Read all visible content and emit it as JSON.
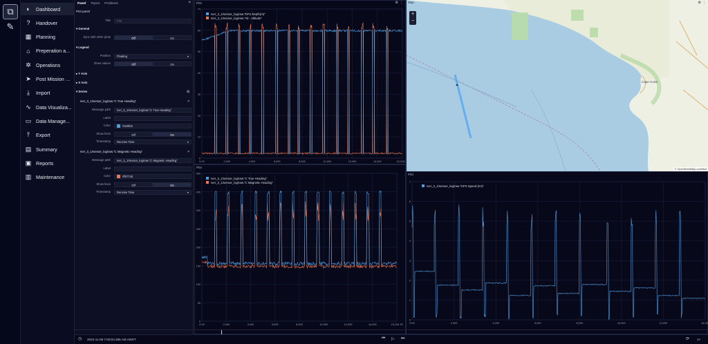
{
  "rail": {
    "icons": [
      "layers-icon",
      "wrench-icon"
    ]
  },
  "nav": {
    "items": [
      {
        "label": "Dashboard",
        "icon": "◐"
      },
      {
        "label": "Handover",
        "icon": "?"
      },
      {
        "label": "Planning",
        "icon": "▦"
      },
      {
        "label": "Preperation a...",
        "icon": "⌂"
      },
      {
        "label": "Operations",
        "icon": "✲"
      },
      {
        "label": "Post Mission a...",
        "icon": "➤"
      },
      {
        "label": "Import",
        "icon": "⤓"
      },
      {
        "label": "Data Visualiza...",
        "icon": "∿"
      },
      {
        "label": "Data Manage...",
        "icon": "▭"
      },
      {
        "label": "Export",
        "icon": "⤒"
      },
      {
        "label": "Summary",
        "icon": "▤"
      },
      {
        "label": "Reports",
        "icon": "▣"
      },
      {
        "label": "Maintenance",
        "icon": "▥"
      }
    ]
  },
  "panel": {
    "tabs": [
      "Panel",
      "Topics",
      "Problems"
    ],
    "close": "×",
    "subtitle": "Plot panel",
    "title_label": "Title",
    "title_placeholder": "Plot",
    "general": "General",
    "sync_label": "Sync with other plots",
    "off": "Off",
    "on": "On",
    "legend": "Legend",
    "position_label": "Position",
    "position_value": "Floating",
    "show_values_label": "Show values",
    "y_axis": "Y Axis",
    "x_axis": "X Axis",
    "series": "Series",
    "series1": {
      "header": "Iver_3_1/sensor_log/raw.\"C True Heading\"",
      "path_label": "Message path",
      "path": "Iver_3_1/sensor_log/raw.\"C True Heading\"",
      "label_label": "Label",
      "color_label": "Color",
      "color": "#4e9fe2",
      "lines_label": "Show lines",
      "ts_label": "Timestamp",
      "ts": "Receive Time"
    },
    "series2": {
      "header": "Iver_3_1/sensor_log/raw.\"C Magnetic Heading\"",
      "path_label": "Message path",
      "path": "Iver_3_1/sensor_log/raw.\"C Magnetic Heading\"",
      "label_label": "Label",
      "color_label": "Color",
      "color": "#f5774d",
      "lines_label": "Show lines",
      "ts_label": "Timestamp",
      "ts": "Receive Time"
    }
  },
  "plot1": {
    "title": "Plot",
    "legend": [
      "Iver_3_1/sensor_log/raw.\"DFS Depth(m)\"",
      "Iver_3_1/sensor_log/raw.\"Alt - Altitude\""
    ],
    "colors": [
      "#4e9fe2",
      "#f5774d"
    ],
    "yticks": [
      "74",
      "60",
      "50",
      "40",
      "30",
      "20",
      "10",
      "0"
    ],
    "xticks": [
      "0.00",
      "2,000",
      "4,000",
      "6,000",
      "8,000",
      "10,000",
      "12,000",
      "14,000",
      "15,216.76"
    ]
  },
  "plot2": {
    "title": "Plot",
    "legend": [
      "Iver_3_1/sensor_log/raw.\"C True Heading\"",
      "Iver_3_1/sensor_log/raw.\"C Magnetic Heading\""
    ],
    "colors": [
      "#4e9fe2",
      "#f5774d"
    ],
    "yticks": [
      "400",
      "350",
      "300",
      "250",
      "200",
      "150",
      "100",
      "50",
      "0"
    ],
    "xticks": [
      "0.00",
      "2,000",
      "4,000",
      "6,000",
      "8,000",
      "10,000",
      "12,000",
      "14,000",
      "15,216.76"
    ]
  },
  "plot3": {
    "title": "Plot",
    "legend": [
      "Iver_3_1/sensor_log/raw.\"GPS Speed (Kn)\""
    ],
    "colors": [
      "#4e9fe2"
    ],
    "yticks": [
      "7",
      "6",
      "5",
      "4",
      "3",
      "2",
      "1",
      "0"
    ],
    "xticks": [
      "0.00",
      "2,000",
      "4,000",
      "6,000",
      "8,000",
      "10,000",
      "12,000",
      "14,000"
    ]
  },
  "map": {
    "title": "Map",
    "zoom_in": "+",
    "zoom_out": "−",
    "attribution": "© OpenStreetMap contribut",
    "place": "Cape Coral",
    "gear": "⚙",
    "dots": "⋮"
  },
  "timeline": {
    "time": "2022-11-08 7:00:04.355 AM AWST",
    "speed": "1×"
  }
}
